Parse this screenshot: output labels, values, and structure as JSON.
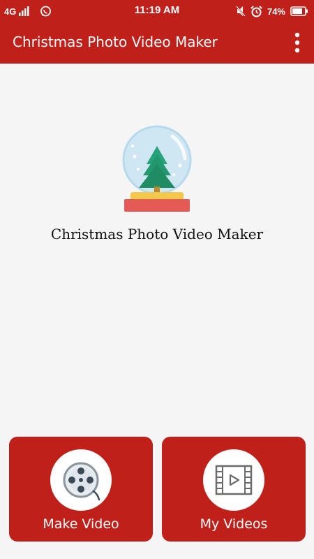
{
  "status_bar": {
    "network": "4G",
    "time": "11:19 AM",
    "battery": "74%",
    "icons": [
      "signal-icon",
      "whatsapp-icon",
      "mute-icon",
      "alarm-icon",
      "battery-icon"
    ]
  },
  "app_bar": {
    "title": "Christmas Photo Video Maker",
    "menu_icon": "overflow-menu-icon"
  },
  "main": {
    "logo_icon": "snow-globe-icon",
    "app_name": "Christmas Photo Video Maker"
  },
  "actions": [
    {
      "label": "Make Video",
      "icon": "film-reel-icon"
    },
    {
      "label": "My Videos",
      "icon": "video-film-icon"
    }
  ],
  "colors": {
    "primary": "#c0201a",
    "background": "#f5f5f5"
  }
}
